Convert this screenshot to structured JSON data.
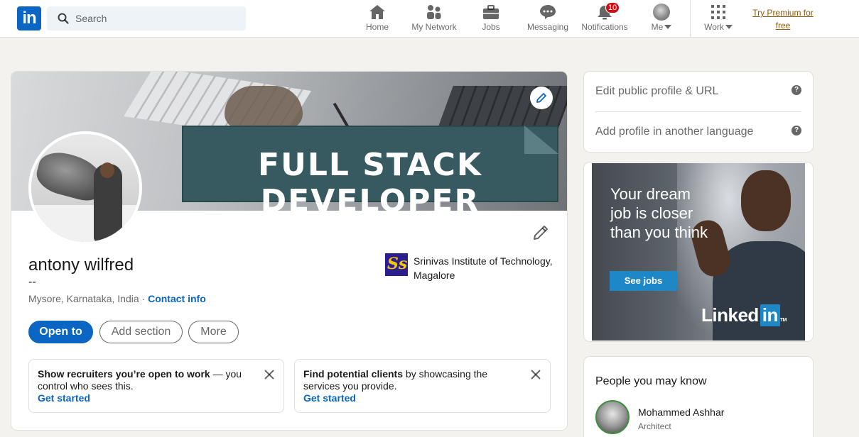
{
  "nav": {
    "logo": "in",
    "search_placeholder": "Search",
    "items": [
      {
        "label": "Home",
        "icon": "home-icon"
      },
      {
        "label": "My Network",
        "icon": "network-icon"
      },
      {
        "label": "Jobs",
        "icon": "briefcase-icon"
      },
      {
        "label": "Messaging",
        "icon": "messaging-icon"
      },
      {
        "label": "Notifications",
        "icon": "bell-icon",
        "badge": "10"
      },
      {
        "label": "Me",
        "icon": "avatar-icon"
      },
      {
        "label": "Work",
        "icon": "grid-icon"
      }
    ],
    "premium": "Try Premium for free"
  },
  "profile": {
    "banner_text": "FULL STACK DEVELOPER",
    "name": "antony wilfred",
    "headline": "--",
    "location": "Mysore, Karnataka, India",
    "separator": " · ",
    "contact_info": "Contact info",
    "school": "Srinivas Institute of Technology, Magalore",
    "school_logo_text": "Ss",
    "buttons": {
      "open_to": "Open to",
      "add_section": "Add section",
      "more": "More"
    },
    "tips": [
      {
        "bold": "Show recruiters you’re open to work",
        "rest": " — you control who sees this.",
        "link": "Get started"
      },
      {
        "bold": "Find potential clients",
        "rest": " by showcasing the services you provide.",
        "link": "Get started"
      }
    ]
  },
  "rail": {
    "links": [
      "Edit public profile & URL",
      "Add profile in another language"
    ],
    "help_glyph": "?",
    "ad": {
      "text": "Your dream job is closer than you think",
      "button": "See jobs",
      "logo_main": "Linked",
      "logo_in": "in",
      "logo_tm": "TM"
    },
    "pymk": {
      "title": "People you may know",
      "people": [
        {
          "name": "Mohammed Ashhar",
          "role": "Architect"
        }
      ]
    }
  },
  "colors": {
    "brand": "#0a66c2",
    "badge": "#cc1016",
    "premium": "#915907",
    "banner_sign": "#365a60"
  }
}
